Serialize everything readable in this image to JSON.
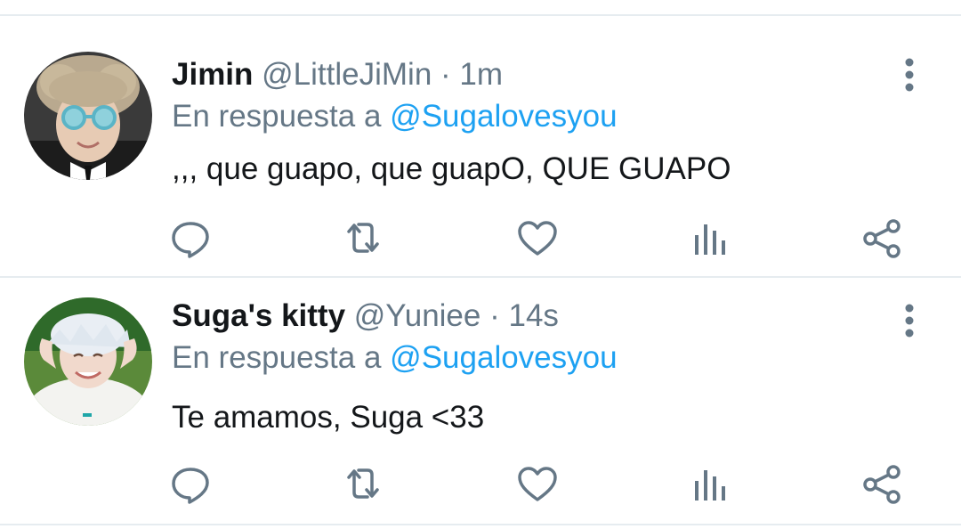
{
  "colors": {
    "name": "#14171a",
    "secondary": "#657786",
    "link": "#1da1f2",
    "icon": "#657786",
    "divider": "#e6ecf0"
  },
  "tweets": [
    {
      "display_name": "Jimin",
      "handle": "@LittleJiMin",
      "separator": "·",
      "time": "1m",
      "reply_prefix": "En respuesta a",
      "reply_handle": "@Sugalovesyou",
      "text": ",,, que guapo, que guapO, QUE GUAPO",
      "icons": [
        "reply-icon",
        "retweet-icon",
        "like-icon",
        "analytics-icon",
        "share-icon",
        "more-icon"
      ]
    },
    {
      "display_name": "Suga's kitty",
      "handle": "@Yuniee",
      "separator": "·",
      "time": "14s",
      "reply_prefix": "En respuesta a",
      "reply_handle": "@Sugalovesyou",
      "text": "Te amamos, Suga <33",
      "icons": [
        "reply-icon",
        "retweet-icon",
        "like-icon",
        "analytics-icon",
        "share-icon",
        "more-icon"
      ]
    }
  ]
}
